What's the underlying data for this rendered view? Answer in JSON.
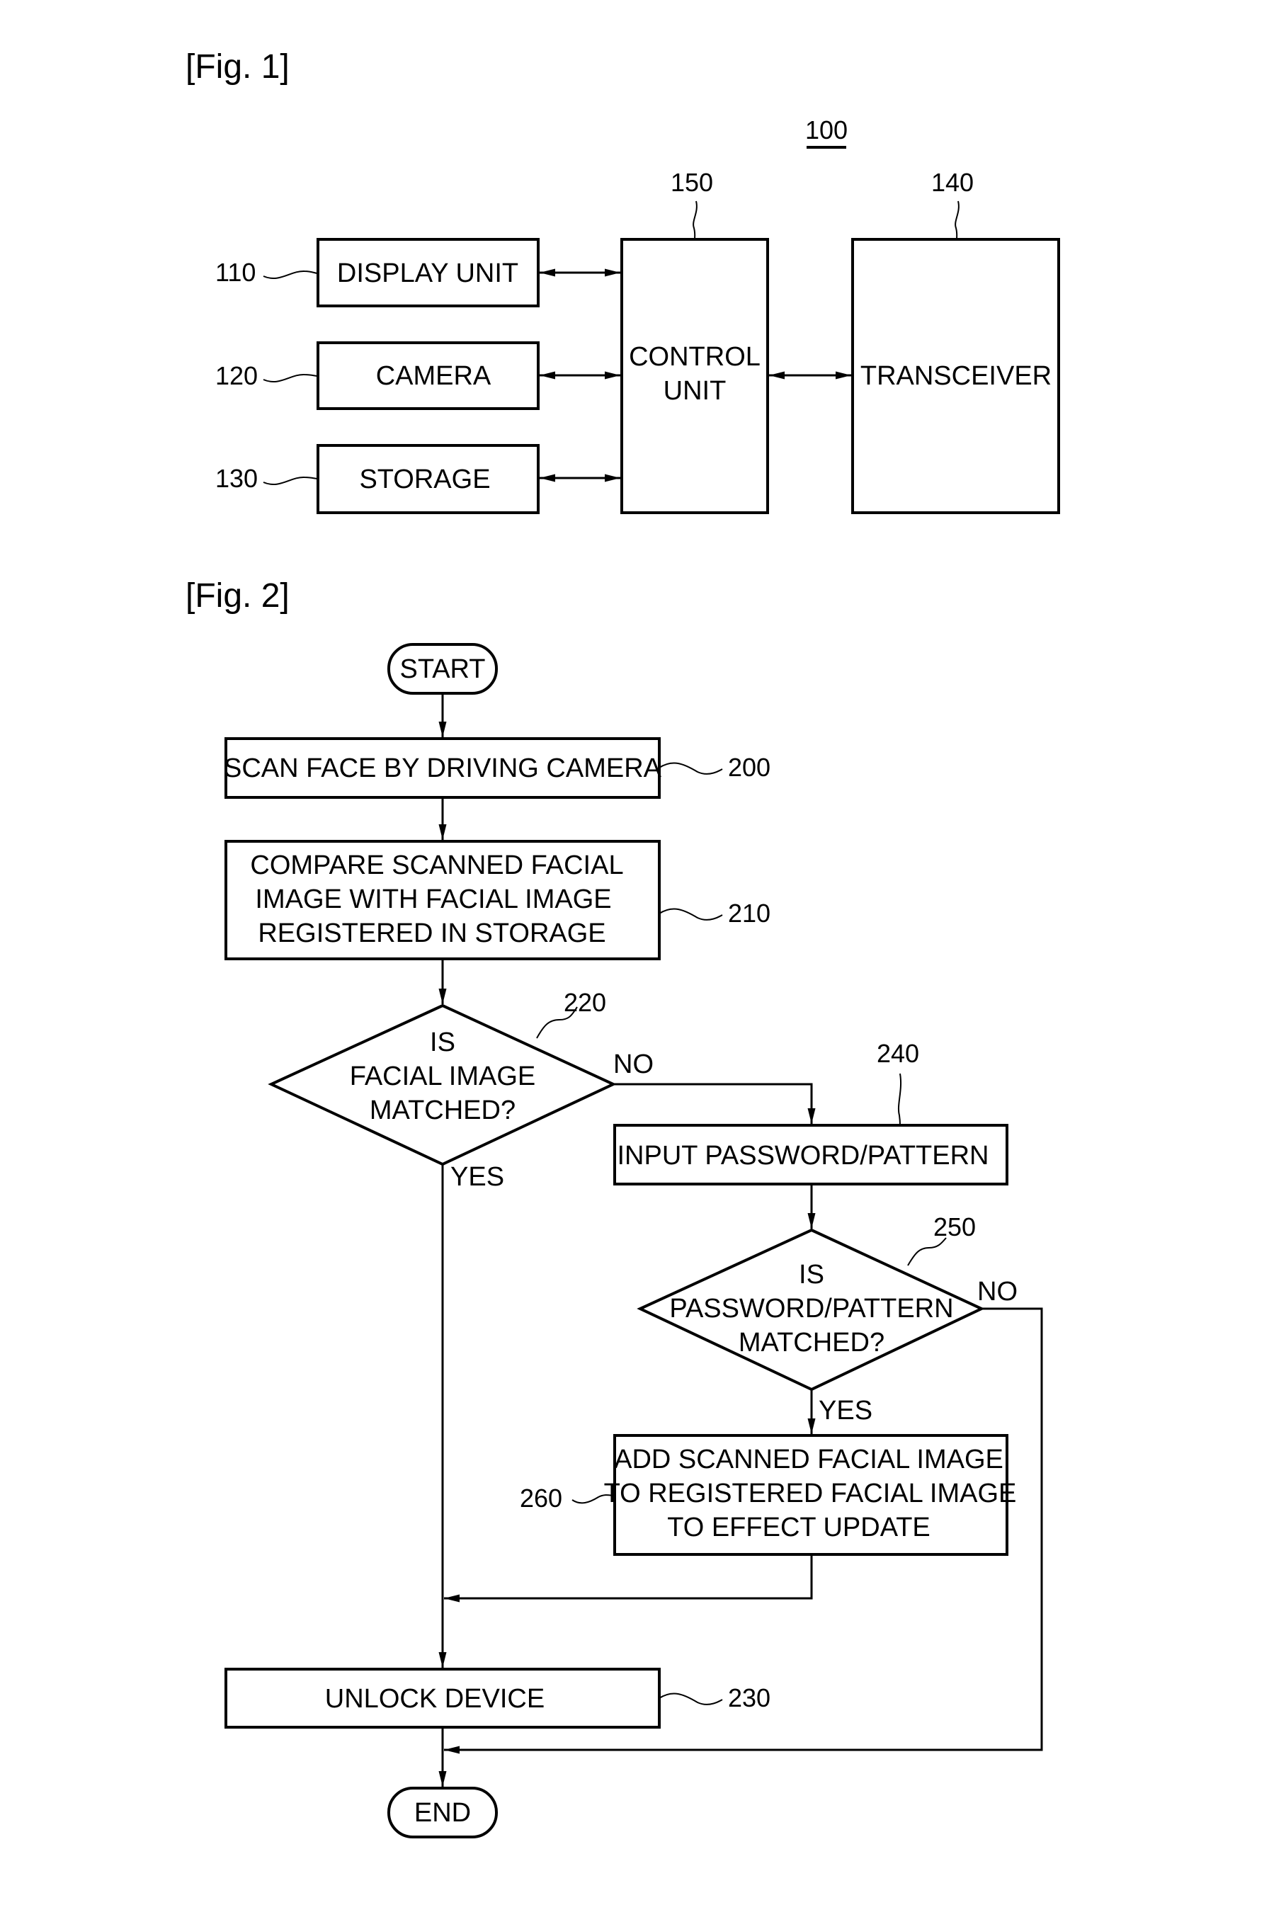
{
  "fig1": {
    "title": "[Fig. 1]",
    "system_ref": "100",
    "blocks": {
      "display_unit": {
        "label": "DISPLAY UNIT",
        "ref": "110"
      },
      "camera": {
        "label": "CAMERA",
        "ref": "120"
      },
      "storage": {
        "label": "STORAGE",
        "ref": "130"
      },
      "control_unit": {
        "label_line1": "CONTROL",
        "label_line2": "UNIT",
        "ref": "150"
      },
      "transceiver": {
        "label": "TRANSCEIVER",
        "ref": "140"
      }
    }
  },
  "fig2": {
    "title": "[Fig. 2]",
    "start": "START",
    "end": "END",
    "steps": {
      "scan": {
        "text": "SCAN FACE BY DRIVING CAMERA",
        "ref": "200"
      },
      "compare": {
        "lines": [
          "COMPARE SCANNED FACIAL",
          "IMAGE WITH FACIAL IMAGE",
          "REGISTERED IN STORAGE"
        ],
        "ref": "210"
      },
      "face_match": {
        "lines": [
          "IS",
          "FACIAL IMAGE",
          "MATCHED?"
        ],
        "ref": "220"
      },
      "unlock": {
        "text": "UNLOCK DEVICE",
        "ref": "230"
      },
      "input_password": {
        "text": "INPUT PASSWORD/PATTERN",
        "ref": "240"
      },
      "password_match": {
        "lines": [
          "IS",
          "PASSWORD/PATTERN",
          "MATCHED?"
        ],
        "ref": "250"
      },
      "update": {
        "lines": [
          "ADD SCANNED FACIAL IMAGE",
          "TO REGISTERED FACIAL IMAGE",
          "TO EFFECT UPDATE"
        ],
        "ref": "260"
      }
    },
    "branch_labels": {
      "face_no": "NO",
      "face_yes": "YES",
      "password_no": "NO",
      "password_yes": "YES"
    }
  }
}
